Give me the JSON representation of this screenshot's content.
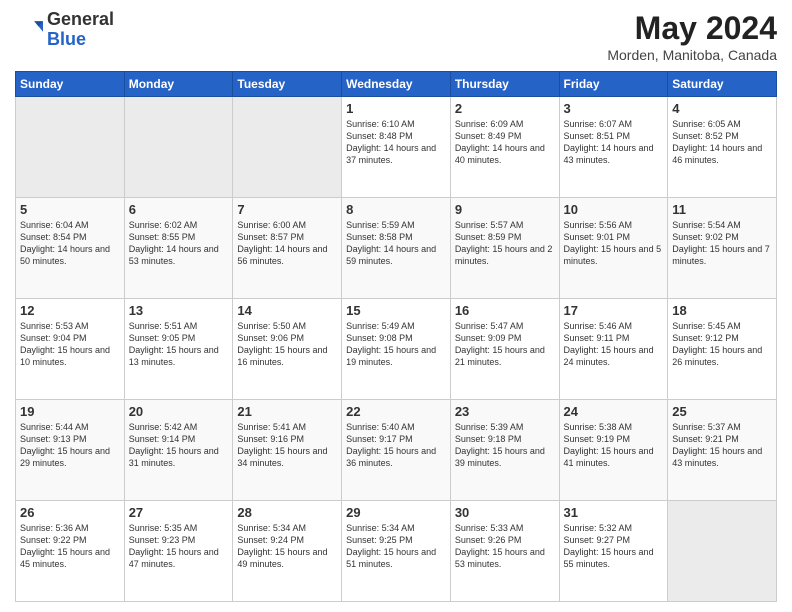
{
  "header": {
    "logo_general": "General",
    "logo_blue": "Blue",
    "title": "May 2024",
    "subtitle": "Morden, Manitoba, Canada"
  },
  "weekdays": [
    "Sunday",
    "Monday",
    "Tuesday",
    "Wednesday",
    "Thursday",
    "Friday",
    "Saturday"
  ],
  "weeks": [
    [
      {
        "day": "",
        "empty": true
      },
      {
        "day": "",
        "empty": true
      },
      {
        "day": "",
        "empty": true
      },
      {
        "day": "1",
        "sunrise": "6:10 AM",
        "sunset": "8:48 PM",
        "daylight": "14 hours and 37 minutes."
      },
      {
        "day": "2",
        "sunrise": "6:09 AM",
        "sunset": "8:49 PM",
        "daylight": "14 hours and 40 minutes."
      },
      {
        "day": "3",
        "sunrise": "6:07 AM",
        "sunset": "8:51 PM",
        "daylight": "14 hours and 43 minutes."
      },
      {
        "day": "4",
        "sunrise": "6:05 AM",
        "sunset": "8:52 PM",
        "daylight": "14 hours and 46 minutes."
      }
    ],
    [
      {
        "day": "5",
        "sunrise": "6:04 AM",
        "sunset": "8:54 PM",
        "daylight": "14 hours and 50 minutes."
      },
      {
        "day": "6",
        "sunrise": "6:02 AM",
        "sunset": "8:55 PM",
        "daylight": "14 hours and 53 minutes."
      },
      {
        "day": "7",
        "sunrise": "6:00 AM",
        "sunset": "8:57 PM",
        "daylight": "14 hours and 56 minutes."
      },
      {
        "day": "8",
        "sunrise": "5:59 AM",
        "sunset": "8:58 PM",
        "daylight": "14 hours and 59 minutes."
      },
      {
        "day": "9",
        "sunrise": "5:57 AM",
        "sunset": "8:59 PM",
        "daylight": "15 hours and 2 minutes."
      },
      {
        "day": "10",
        "sunrise": "5:56 AM",
        "sunset": "9:01 PM",
        "daylight": "15 hours and 5 minutes."
      },
      {
        "day": "11",
        "sunrise": "5:54 AM",
        "sunset": "9:02 PM",
        "daylight": "15 hours and 7 minutes."
      }
    ],
    [
      {
        "day": "12",
        "sunrise": "5:53 AM",
        "sunset": "9:04 PM",
        "daylight": "15 hours and 10 minutes."
      },
      {
        "day": "13",
        "sunrise": "5:51 AM",
        "sunset": "9:05 PM",
        "daylight": "15 hours and 13 minutes."
      },
      {
        "day": "14",
        "sunrise": "5:50 AM",
        "sunset": "9:06 PM",
        "daylight": "15 hours and 16 minutes."
      },
      {
        "day": "15",
        "sunrise": "5:49 AM",
        "sunset": "9:08 PM",
        "daylight": "15 hours and 19 minutes."
      },
      {
        "day": "16",
        "sunrise": "5:47 AM",
        "sunset": "9:09 PM",
        "daylight": "15 hours and 21 minutes."
      },
      {
        "day": "17",
        "sunrise": "5:46 AM",
        "sunset": "9:11 PM",
        "daylight": "15 hours and 24 minutes."
      },
      {
        "day": "18",
        "sunrise": "5:45 AM",
        "sunset": "9:12 PM",
        "daylight": "15 hours and 26 minutes."
      }
    ],
    [
      {
        "day": "19",
        "sunrise": "5:44 AM",
        "sunset": "9:13 PM",
        "daylight": "15 hours and 29 minutes."
      },
      {
        "day": "20",
        "sunrise": "5:42 AM",
        "sunset": "9:14 PM",
        "daylight": "15 hours and 31 minutes."
      },
      {
        "day": "21",
        "sunrise": "5:41 AM",
        "sunset": "9:16 PM",
        "daylight": "15 hours and 34 minutes."
      },
      {
        "day": "22",
        "sunrise": "5:40 AM",
        "sunset": "9:17 PM",
        "daylight": "15 hours and 36 minutes."
      },
      {
        "day": "23",
        "sunrise": "5:39 AM",
        "sunset": "9:18 PM",
        "daylight": "15 hours and 39 minutes."
      },
      {
        "day": "24",
        "sunrise": "5:38 AM",
        "sunset": "9:19 PM",
        "daylight": "15 hours and 41 minutes."
      },
      {
        "day": "25",
        "sunrise": "5:37 AM",
        "sunset": "9:21 PM",
        "daylight": "15 hours and 43 minutes."
      }
    ],
    [
      {
        "day": "26",
        "sunrise": "5:36 AM",
        "sunset": "9:22 PM",
        "daylight": "15 hours and 45 minutes."
      },
      {
        "day": "27",
        "sunrise": "5:35 AM",
        "sunset": "9:23 PM",
        "daylight": "15 hours and 47 minutes."
      },
      {
        "day": "28",
        "sunrise": "5:34 AM",
        "sunset": "9:24 PM",
        "daylight": "15 hours and 49 minutes."
      },
      {
        "day": "29",
        "sunrise": "5:34 AM",
        "sunset": "9:25 PM",
        "daylight": "15 hours and 51 minutes."
      },
      {
        "day": "30",
        "sunrise": "5:33 AM",
        "sunset": "9:26 PM",
        "daylight": "15 hours and 53 minutes."
      },
      {
        "day": "31",
        "sunrise": "5:32 AM",
        "sunset": "9:27 PM",
        "daylight": "15 hours and 55 minutes."
      },
      {
        "day": "",
        "empty": true
      }
    ]
  ]
}
